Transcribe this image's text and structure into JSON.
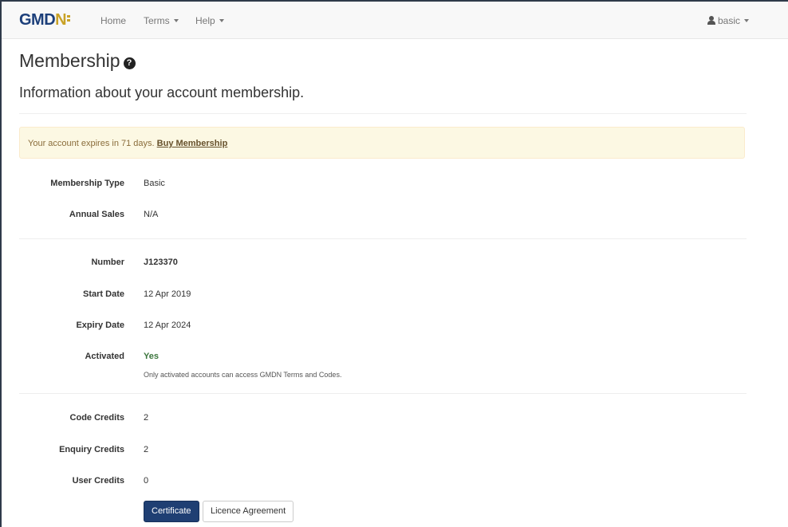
{
  "navbar": {
    "brand_prefix": "GMD",
    "brand_letter": "N",
    "home": "Home",
    "terms": "Terms",
    "help": "Help",
    "user": "basic"
  },
  "page": {
    "title": "Membership",
    "subtitle": "Information about your account membership."
  },
  "alert": {
    "text": "Your account expires in 71 days.",
    "link": "Buy Membership"
  },
  "fields": {
    "membership_type": {
      "label": "Membership Type",
      "value": "Basic"
    },
    "annual_sales": {
      "label": "Annual Sales",
      "value": "N/A"
    },
    "number": {
      "label": "Number",
      "value": "J123370"
    },
    "start_date": {
      "label": "Start Date",
      "value": "12 Apr 2019"
    },
    "expiry_date": {
      "label": "Expiry Date",
      "value": "12 Apr 2024"
    },
    "activated": {
      "label": "Activated",
      "value": "Yes",
      "help": "Only activated accounts can access GMDN Terms and Codes."
    },
    "code_credits": {
      "label": "Code Credits",
      "value": "2"
    },
    "enquiry_credits": {
      "label": "Enquiry Credits",
      "value": "2"
    },
    "user_credits": {
      "label": "User Credits",
      "value": "0"
    }
  },
  "buttons": {
    "certificate": "Certificate",
    "licence": "Licence Agreement"
  },
  "colors": {
    "brand_blue": "#1c3f7a",
    "brand_gold": "#c9a227",
    "primary_button": "#1f3f73",
    "alert_bg": "#fcf8e3",
    "success_text": "#3c763d"
  }
}
